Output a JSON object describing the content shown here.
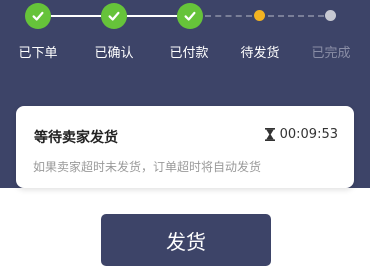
{
  "steps": [
    {
      "label": "已下单",
      "status": "done",
      "icon": "check-icon"
    },
    {
      "label": "已确认",
      "status": "done",
      "icon": "check-icon"
    },
    {
      "label": "已付款",
      "status": "done",
      "icon": "check-icon"
    },
    {
      "label": "待发货",
      "status": "current",
      "icon": "current-dot-icon"
    },
    {
      "label": "已完成",
      "status": "pending",
      "icon": "pending-dot-icon"
    }
  ],
  "status_card": {
    "title": "等待卖家发货",
    "countdown": "00:09:53",
    "countdown_icon": "hourglass-icon",
    "description": "如果卖家超时未发货，订单超时将自动发货"
  },
  "action_button": {
    "label": "发货"
  },
  "colors": {
    "header_bg": "#3d4468",
    "done_green": "#66c33a",
    "current_yellow": "#f3b321",
    "pending_gray": "#c7c9d2",
    "button_bg": "#3d4468"
  }
}
